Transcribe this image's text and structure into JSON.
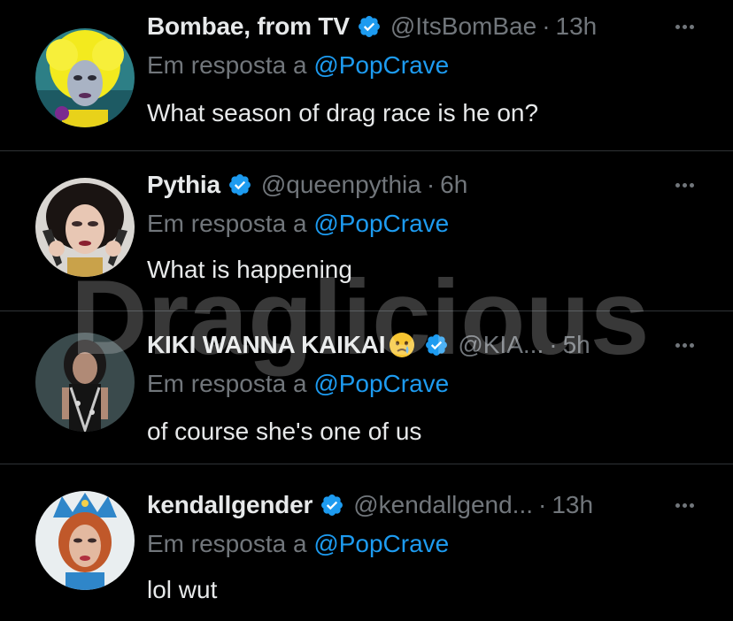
{
  "reply_prefix": "Em resposta a",
  "watermark_text": "Draglicious",
  "colors": {
    "background": "#000000",
    "text": "#e7e9ea",
    "muted": "#71767b",
    "link": "#1d9bf0",
    "verified": "#1d9bf0",
    "divider": "#2f3336"
  },
  "tweets": [
    {
      "name": "Bombae, from TV",
      "verified": true,
      "handle": "@ItsBomBae",
      "time": "13h",
      "reply_to": "@PopCrave",
      "text": "What season of drag race is he on?",
      "avatar_icon": "avatar-yellow-hair"
    },
    {
      "name": "Pythia",
      "verified": true,
      "handle": "@queenpythia",
      "time": "6h",
      "reply_to": "@PopCrave",
      "text": "What is happening",
      "avatar_icon": "avatar-dark-hair"
    },
    {
      "name": "KIKI WANNA KAIKAI",
      "emoji": "crying-face-emoji",
      "verified": true,
      "handle": "@KIA...",
      "time": "5h",
      "reply_to": "@PopCrave",
      "text": "of course she's one of us",
      "avatar_icon": "avatar-black-outfit"
    },
    {
      "name": "kendallgender",
      "verified": true,
      "handle": "@kendallgend...",
      "time": "13h",
      "reply_to": "@PopCrave",
      "text": "lol wut",
      "avatar_icon": "avatar-blue-crown"
    }
  ]
}
